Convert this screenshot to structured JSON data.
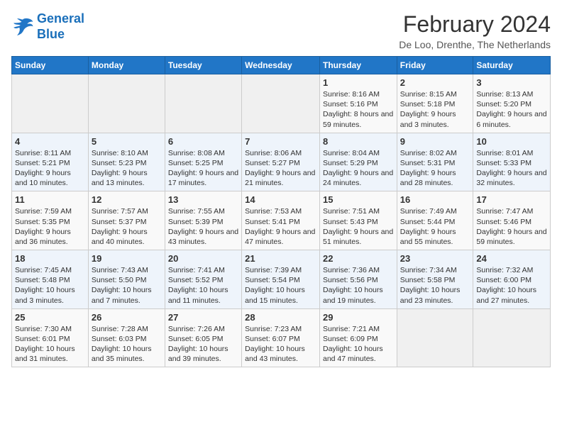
{
  "logo": {
    "line1": "General",
    "line2": "Blue"
  },
  "title": "February 2024",
  "location": "De Loo, Drenthe, The Netherlands",
  "days_of_week": [
    "Sunday",
    "Monday",
    "Tuesday",
    "Wednesday",
    "Thursday",
    "Friday",
    "Saturday"
  ],
  "weeks": [
    [
      {
        "day": "",
        "info": ""
      },
      {
        "day": "",
        "info": ""
      },
      {
        "day": "",
        "info": ""
      },
      {
        "day": "",
        "info": ""
      },
      {
        "day": "1",
        "info": "Sunrise: 8:16 AM\nSunset: 5:16 PM\nDaylight: 8 hours and 59 minutes."
      },
      {
        "day": "2",
        "info": "Sunrise: 8:15 AM\nSunset: 5:18 PM\nDaylight: 9 hours and 3 minutes."
      },
      {
        "day": "3",
        "info": "Sunrise: 8:13 AM\nSunset: 5:20 PM\nDaylight: 9 hours and 6 minutes."
      }
    ],
    [
      {
        "day": "4",
        "info": "Sunrise: 8:11 AM\nSunset: 5:21 PM\nDaylight: 9 hours and 10 minutes."
      },
      {
        "day": "5",
        "info": "Sunrise: 8:10 AM\nSunset: 5:23 PM\nDaylight: 9 hours and 13 minutes."
      },
      {
        "day": "6",
        "info": "Sunrise: 8:08 AM\nSunset: 5:25 PM\nDaylight: 9 hours and 17 minutes."
      },
      {
        "day": "7",
        "info": "Sunrise: 8:06 AM\nSunset: 5:27 PM\nDaylight: 9 hours and 21 minutes."
      },
      {
        "day": "8",
        "info": "Sunrise: 8:04 AM\nSunset: 5:29 PM\nDaylight: 9 hours and 24 minutes."
      },
      {
        "day": "9",
        "info": "Sunrise: 8:02 AM\nSunset: 5:31 PM\nDaylight: 9 hours and 28 minutes."
      },
      {
        "day": "10",
        "info": "Sunrise: 8:01 AM\nSunset: 5:33 PM\nDaylight: 9 hours and 32 minutes."
      }
    ],
    [
      {
        "day": "11",
        "info": "Sunrise: 7:59 AM\nSunset: 5:35 PM\nDaylight: 9 hours and 36 minutes."
      },
      {
        "day": "12",
        "info": "Sunrise: 7:57 AM\nSunset: 5:37 PM\nDaylight: 9 hours and 40 minutes."
      },
      {
        "day": "13",
        "info": "Sunrise: 7:55 AM\nSunset: 5:39 PM\nDaylight: 9 hours and 43 minutes."
      },
      {
        "day": "14",
        "info": "Sunrise: 7:53 AM\nSunset: 5:41 PM\nDaylight: 9 hours and 47 minutes."
      },
      {
        "day": "15",
        "info": "Sunrise: 7:51 AM\nSunset: 5:43 PM\nDaylight: 9 hours and 51 minutes."
      },
      {
        "day": "16",
        "info": "Sunrise: 7:49 AM\nSunset: 5:44 PM\nDaylight: 9 hours and 55 minutes."
      },
      {
        "day": "17",
        "info": "Sunrise: 7:47 AM\nSunset: 5:46 PM\nDaylight: 9 hours and 59 minutes."
      }
    ],
    [
      {
        "day": "18",
        "info": "Sunrise: 7:45 AM\nSunset: 5:48 PM\nDaylight: 10 hours and 3 minutes."
      },
      {
        "day": "19",
        "info": "Sunrise: 7:43 AM\nSunset: 5:50 PM\nDaylight: 10 hours and 7 minutes."
      },
      {
        "day": "20",
        "info": "Sunrise: 7:41 AM\nSunset: 5:52 PM\nDaylight: 10 hours and 11 minutes."
      },
      {
        "day": "21",
        "info": "Sunrise: 7:39 AM\nSunset: 5:54 PM\nDaylight: 10 hours and 15 minutes."
      },
      {
        "day": "22",
        "info": "Sunrise: 7:36 AM\nSunset: 5:56 PM\nDaylight: 10 hours and 19 minutes."
      },
      {
        "day": "23",
        "info": "Sunrise: 7:34 AM\nSunset: 5:58 PM\nDaylight: 10 hours and 23 minutes."
      },
      {
        "day": "24",
        "info": "Sunrise: 7:32 AM\nSunset: 6:00 PM\nDaylight: 10 hours and 27 minutes."
      }
    ],
    [
      {
        "day": "25",
        "info": "Sunrise: 7:30 AM\nSunset: 6:01 PM\nDaylight: 10 hours and 31 minutes."
      },
      {
        "day": "26",
        "info": "Sunrise: 7:28 AM\nSunset: 6:03 PM\nDaylight: 10 hours and 35 minutes."
      },
      {
        "day": "27",
        "info": "Sunrise: 7:26 AM\nSunset: 6:05 PM\nDaylight: 10 hours and 39 minutes."
      },
      {
        "day": "28",
        "info": "Sunrise: 7:23 AM\nSunset: 6:07 PM\nDaylight: 10 hours and 43 minutes."
      },
      {
        "day": "29",
        "info": "Sunrise: 7:21 AM\nSunset: 6:09 PM\nDaylight: 10 hours and 47 minutes."
      },
      {
        "day": "",
        "info": ""
      },
      {
        "day": "",
        "info": ""
      }
    ]
  ]
}
